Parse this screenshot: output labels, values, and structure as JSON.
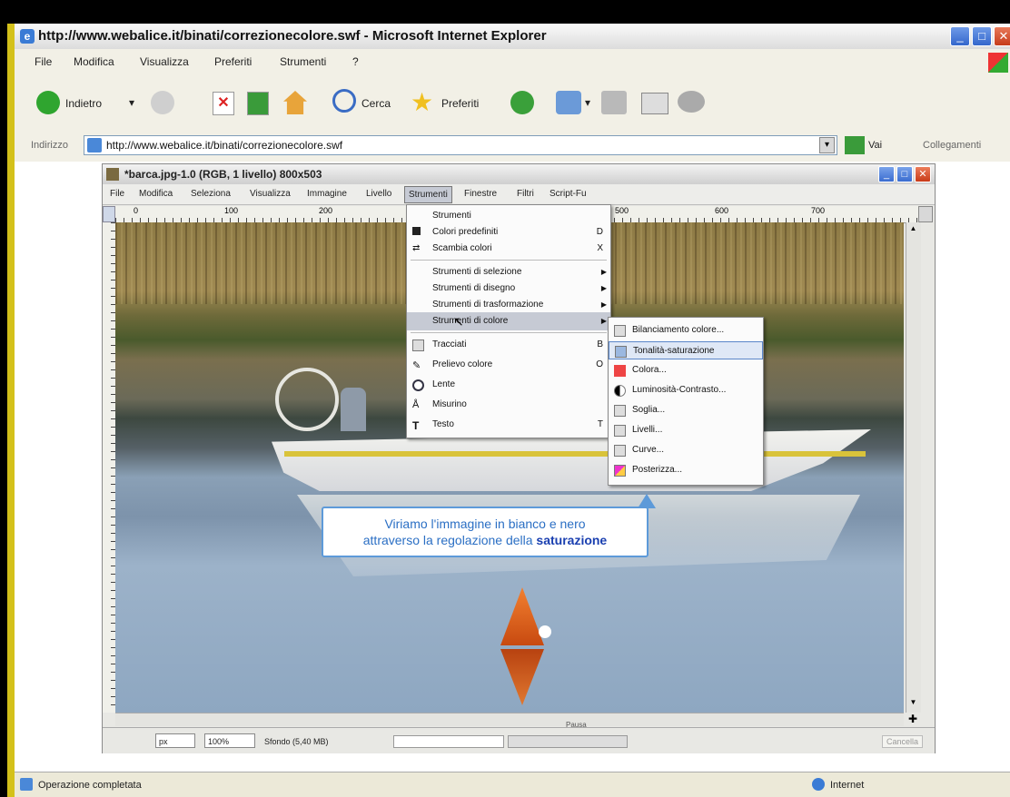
{
  "ie": {
    "title": "http://www.webalice.it/binati/correzionecolore.swf - Microsoft Internet Explorer",
    "menu": [
      "File",
      "Modifica",
      "Visualizza",
      "Preferiti",
      "Strumenti",
      "?"
    ],
    "toolbar": {
      "back": "Indietro",
      "search": "Cerca",
      "favorites": "Preferiti"
    },
    "address_label": "Indirizzo",
    "address_value": "http://www.webalice.it/binati/correzionecolore.swf",
    "go_label": "Vai",
    "links_label": "Collegamenti",
    "status_text": "Operazione completata",
    "zone_text": "Internet"
  },
  "gimp": {
    "title": "*barca.jpg-1.0 (RGB, 1 livello) 800x503",
    "menu": [
      "File",
      "Modifica",
      "Seleziona",
      "Visualizza",
      "Immagine",
      "Livello",
      "Strumenti",
      "Finestre",
      "Filtri",
      "Script-Fu"
    ],
    "ruler_marks": [
      "0",
      "100",
      "200",
      "500",
      "600",
      "700"
    ],
    "status": {
      "unit": "px",
      "zoom": "100%",
      "layer": "Sfondo (5,40 MB)",
      "cancel": "Cancella",
      "nav": "Pausa"
    }
  },
  "strumenti_menu": {
    "items": [
      {
        "label": "Strumenti",
        "shortcut": "",
        "arrow": false
      },
      {
        "label": "Colori predefiniti",
        "shortcut": "D",
        "arrow": false
      },
      {
        "label": "Scambia colori",
        "shortcut": "X",
        "arrow": false
      },
      {
        "label": "Strumenti di selezione",
        "shortcut": "",
        "arrow": true
      },
      {
        "label": "Strumenti di disegno",
        "shortcut": "",
        "arrow": true
      },
      {
        "label": "Strumenti di trasformazione",
        "shortcut": "",
        "arrow": true
      },
      {
        "label": "Strumenti di colore",
        "shortcut": "",
        "arrow": true
      },
      {
        "label": "Tracciati",
        "shortcut": "B",
        "arrow": false
      },
      {
        "label": "Prelievo colore",
        "shortcut": "O",
        "arrow": false
      },
      {
        "label": "Lente",
        "shortcut": "",
        "arrow": false
      },
      {
        "label": "Misurino",
        "shortcut": "",
        "arrow": false
      },
      {
        "label": "Testo",
        "shortcut": "T",
        "arrow": false
      }
    ]
  },
  "colore_submenu": {
    "items": [
      "Bilanciamento colore...",
      "Tonalità-saturazione",
      "Colora...",
      "Luminosità-Contrasto...",
      "Soglia...",
      "Livelli...",
      "Curve...",
      "Posterizza..."
    ]
  },
  "tooltip": {
    "line1": "Viriamo l'immagine in bianco e nero",
    "line2_prefix": "attraverso la regolazione della ",
    "line2_bold": "saturazione"
  },
  "colors": {
    "accent": "#2b6fc4",
    "frame": "#d4c11a",
    "highlight": "#c6cad4"
  }
}
